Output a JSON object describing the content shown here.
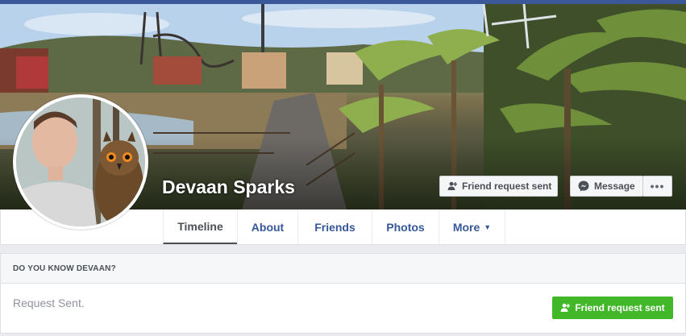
{
  "profile": {
    "name": "Devaan Sparks"
  },
  "cover_actions": {
    "friend_request_label": "Friend request sent",
    "message_label": "Message",
    "more_label": "•••"
  },
  "nav": {
    "tabs": [
      {
        "label": "Timeline",
        "active": true
      },
      {
        "label": "About"
      },
      {
        "label": "Friends"
      },
      {
        "label": "Photos"
      },
      {
        "label": "More"
      }
    ]
  },
  "know_card": {
    "header": "DO YOU KNOW DEVAAN?",
    "status_text": "Request Sent.",
    "button_label": "Friend request sent"
  },
  "icons": {
    "friend": "person-add-icon",
    "message": "messenger-icon",
    "more": "ellipsis-icon",
    "dropdown": "caret-down-icon"
  },
  "colors": {
    "brand_blue": "#3b5998",
    "link_blue": "#365899",
    "green_button": "#42b72a"
  }
}
